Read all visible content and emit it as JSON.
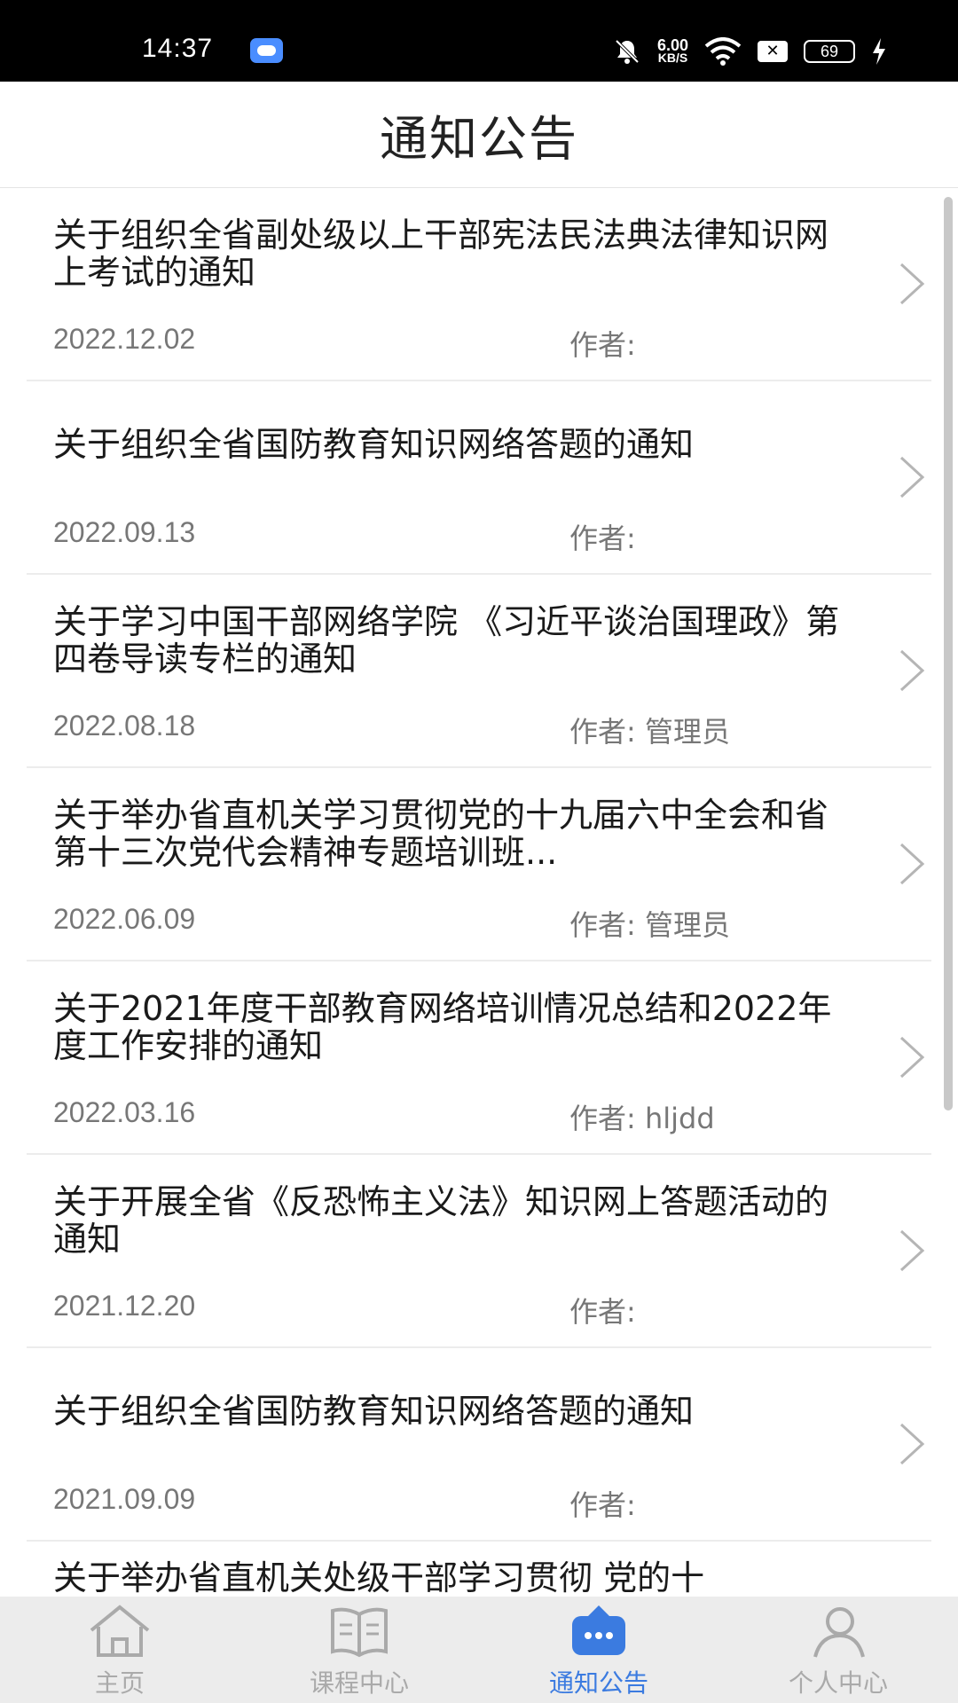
{
  "status": {
    "time": "14:37",
    "speed_value": "6.00",
    "speed_unit": "KB/S",
    "battery": "69"
  },
  "header": {
    "title": "通知公告"
  },
  "notices": [
    {
      "title": "关于组织全省副处级以上干部宪法民法典法律知识网上考试的通知",
      "date": "2022.12.02",
      "author": "作者:"
    },
    {
      "title": "关于组织全省国防教育知识网络答题的通知",
      "date": "2022.09.13",
      "author": "作者:"
    },
    {
      "title": "关于学习中国干部网络学院 《习近平谈治国理政》第四卷导读专栏的通知",
      "date": "2022.08.18",
      "author": "作者: 管理员"
    },
    {
      "title": "关于举办省直机关学习贯彻党的十九届六中全会和省第十三次党代会精神专题培训班...",
      "date": "2022.06.09",
      "author": "作者: 管理员"
    },
    {
      "title": "关于2021年度干部教育网络培训情况总结和2022年度工作安排的通知",
      "date": "2022.03.16",
      "author": "作者: hljdd"
    },
    {
      "title": "关于开展全省《反恐怖主义法》知识网上答题活动的通知",
      "date": "2021.12.20",
      "author": "作者:"
    },
    {
      "title": "关于组织全省国防教育知识网络答题的通知",
      "date": "2021.09.09",
      "author": "作者:"
    },
    {
      "title": "关于举办省直机关处级干部学习贯彻 党的十",
      "date": "",
      "author": ""
    }
  ],
  "tabs": [
    {
      "label": "主页"
    },
    {
      "label": "课程中心"
    },
    {
      "label": "通知公告"
    },
    {
      "label": "个人中心"
    }
  ],
  "colors": {
    "active": "#3b7be0",
    "inactive": "#aaaaaa"
  }
}
